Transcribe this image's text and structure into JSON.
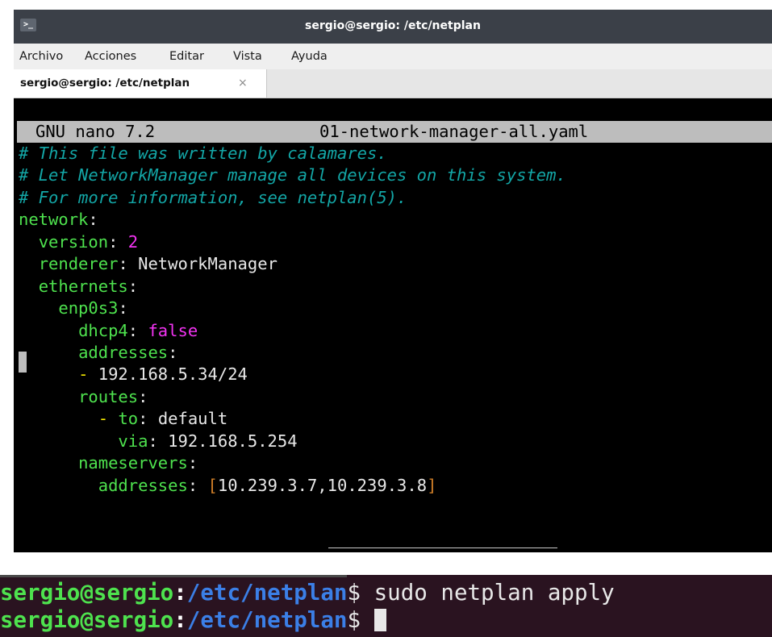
{
  "window": {
    "title": "sergio@sergio: /etc/netplan",
    "icon": "terminal-icon",
    "icon_glyph": ">_"
  },
  "menubar": {
    "items": [
      "Archivo",
      "Acciones",
      "Editar",
      "Vista",
      "Ayuda"
    ]
  },
  "tabs": [
    {
      "label": "sergio@sergio: /etc/netplan",
      "close": "×"
    }
  ],
  "nano": {
    "app": "GNU nano 7.2",
    "filename": "01-network-manager-all.yaml",
    "comments": [
      "# This file was written by calamares.",
      "# Let NetworkManager manage all devices on this system.",
      "# For more information, see netplan(5)."
    ],
    "yaml": {
      "network": "network",
      "version_key": "version",
      "version_val": "2",
      "renderer_key": "renderer",
      "renderer_val": "NetworkManager",
      "ethernets_key": "ethernets",
      "iface_key": "enp0s3",
      "dhcp4_key": "dhcp4",
      "dhcp4_val": "false",
      "addresses_key": "addresses",
      "address_val": "192.168.5.34/24",
      "routes_key": "routes",
      "to_key": "to",
      "to_val": "default",
      "via_key": "via",
      "via_val": "192.168.5.254",
      "nameservers_key": "nameservers",
      "ns_addresses_key": "addresses",
      "ns_addresses_val": "10.239.3.7,10.239.3.8"
    }
  },
  "terminal2": {
    "user": "sergio@sergio",
    "path": "/etc/netplan",
    "prompt_symbol": "$",
    "command": "sudo netplan apply"
  },
  "colors": {
    "comment": "#13a6a6",
    "key": "#4ee24e",
    "number": "#f233f2",
    "path": "#3b7fe6"
  }
}
